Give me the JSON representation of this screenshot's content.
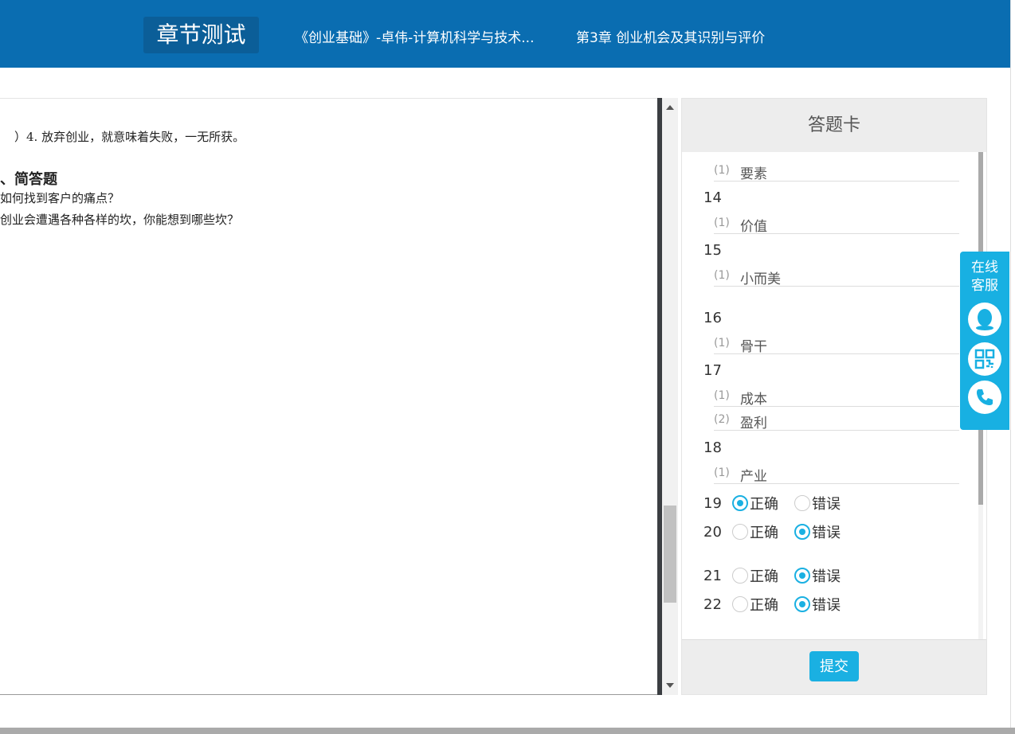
{
  "header": {
    "title": "章节测试",
    "course": "《创业基础》-卓伟-计算机科学与技术...",
    "chapter": "第3章 创业机会及其识别与评价"
  },
  "document": {
    "lines": [
      "）4. 放弃创业，就意味着失败，一无所获。",
      "、简答题",
      "如何找到客户的痛点？",
      "创业会遭遇各种各样的坎，你能想到哪些坎？"
    ]
  },
  "answer_card": {
    "title": "答题卡",
    "fill": [
      {
        "q": "",
        "blanks": [
          {
            "n": "(1)",
            "v": "要素"
          }
        ]
      },
      {
        "q": "14",
        "blanks": [
          {
            "n": "(1)",
            "v": "价值"
          }
        ]
      },
      {
        "q": "15",
        "blanks": [
          {
            "n": "(1)",
            "v": " 小而美"
          }
        ]
      },
      {
        "q": "16",
        "blanks": [
          {
            "n": "(1)",
            "v": "骨干"
          }
        ]
      },
      {
        "q": "17",
        "blanks": [
          {
            "n": "(1)",
            "v": "成本"
          },
          {
            "n": "(2)",
            "v": "盈利"
          }
        ]
      },
      {
        "q": "18",
        "blanks": [
          {
            "n": "(1)",
            "v": "产业"
          }
        ]
      }
    ],
    "true_label": "正确",
    "false_label": "错误",
    "tf": [
      {
        "q": "19",
        "selected": "true"
      },
      {
        "q": "20",
        "selected": "false"
      },
      {
        "q": "21",
        "selected": "false"
      },
      {
        "q": "22",
        "selected": "false"
      }
    ],
    "submit": "提交"
  },
  "float_widget": {
    "label_1": "在线",
    "label_2": "客服",
    "icons": [
      "qq-icon",
      "qr-code-icon",
      "phone-icon"
    ]
  },
  "colors": {
    "header": "#0a6db1",
    "accent": "#1ab0e2"
  }
}
